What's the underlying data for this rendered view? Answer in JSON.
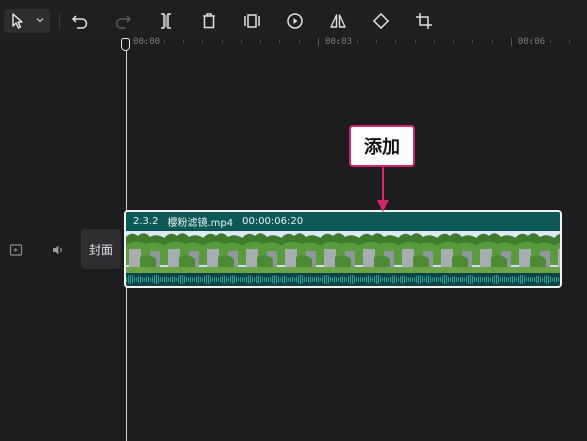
{
  "toolbar": {
    "tools": [
      "select-tool",
      "undo",
      "redo",
      "split",
      "delete",
      "freeze-frame",
      "reverse",
      "mirror",
      "rotate",
      "crop"
    ]
  },
  "ruler": {
    "labels": [
      "00:00",
      "00:03",
      "00:06"
    ]
  },
  "track": {
    "cover_label": "封面"
  },
  "clip": {
    "rate": "2.3.2",
    "filename": "樱粉滤镜.mp4",
    "duration": "00:00:06:20"
  },
  "annotation": {
    "label": "添加",
    "color": "#d6246e"
  },
  "colors": {
    "background": "#1d1d1f",
    "clip_fill": "#0f5858",
    "clip_border": "#f2f2f2"
  }
}
